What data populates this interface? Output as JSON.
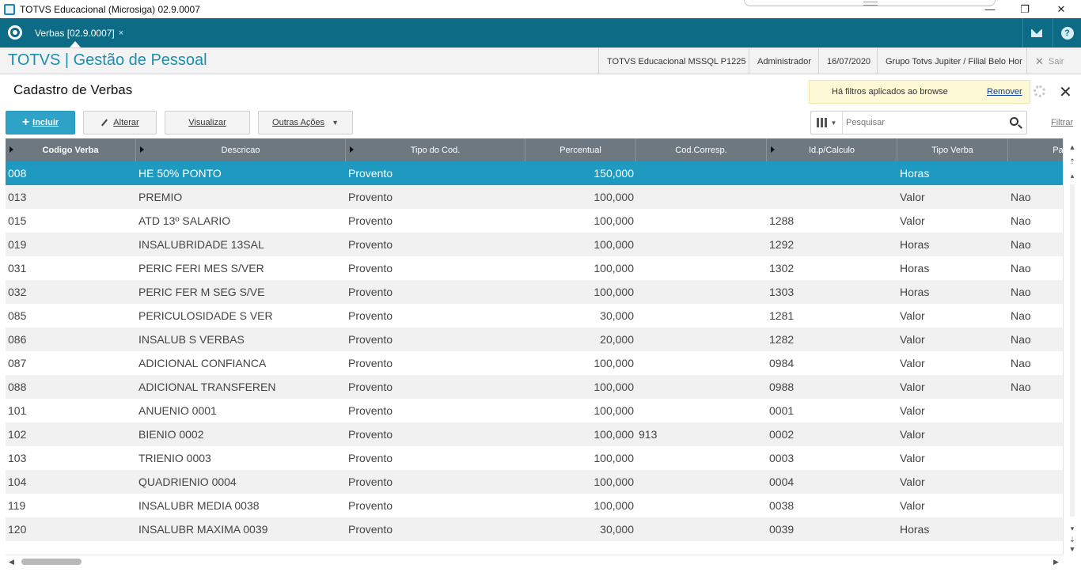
{
  "window": {
    "title": "TOTVS Educacional (Microsiga) 02.9.0007",
    "minimize": "—",
    "maximize": "❐",
    "close": "✕"
  },
  "topbar": {
    "tab_label": "Verbas [02.9.0007]",
    "tab_close": "×",
    "help": "?"
  },
  "header": {
    "brand": "TOTVS | Gestão de Pessoal",
    "environment": "TOTVS Educacional MSSQL P1225",
    "user": "Administrador",
    "date": "16/07/2020",
    "branch": "Grupo Totvs Jupiter / Filial Belo Hor",
    "exit_label": "Sair",
    "exit_icon": "✕"
  },
  "page": {
    "title": "Cadastro de Verbas",
    "filter_message": "Há filtros aplicados ao browse",
    "filter_remove": "Remover",
    "close": "✕"
  },
  "toolbar": {
    "include": "Incluir",
    "include_icon": "+",
    "alter": "Alterar",
    "view": "Visualizar",
    "other_actions": "Outras Ações",
    "other_caret": "▼",
    "search_placeholder": "Pesquisar",
    "columns_caret": "▼",
    "filter": "Filtrar"
  },
  "colors": {
    "topbar": "#0c6b85",
    "brand": "#1a8fb0",
    "selected_row": "#1e9ac0",
    "primary_button": "#2ea3c7",
    "grid_header": "#6e7880"
  },
  "grid": {
    "columns": [
      "Codigo Verba",
      "Descricao",
      "Tipo do Cod.",
      "Percentual",
      "Cod.Corresp.",
      "Id.p/Calculo",
      "Tipo Verba",
      "Pag"
    ],
    "rows": [
      [
        "008",
        "HE 50% PONTO",
        "Provento",
        "150,000",
        "",
        "",
        "Horas",
        ""
      ],
      [
        "013",
        "PREMIO",
        "Provento",
        "100,000",
        "",
        "",
        "Valor",
        "Nao"
      ],
      [
        "015",
        "ATD 13º SALARIO",
        "Provento",
        "100,000",
        "",
        "1288",
        "Valor",
        "Nao"
      ],
      [
        "019",
        "INSALUBRIDADE 13SAL",
        "Provento",
        "100,000",
        "",
        "1292",
        "Horas",
        "Nao"
      ],
      [
        "031",
        "PERIC FERI MES S/VER",
        "Provento",
        "100,000",
        "",
        "1302",
        "Horas",
        "Nao"
      ],
      [
        "032",
        "PERIC FER M SEG S/VE",
        "Provento",
        "100,000",
        "",
        "1303",
        "Horas",
        "Nao"
      ],
      [
        "085",
        "PERICULOSIDADE S VER",
        "Provento",
        "30,000",
        "",
        "1281",
        "Valor",
        "Nao"
      ],
      [
        "086",
        "INSALUB S VERBAS",
        "Provento",
        "20,000",
        "",
        "1282",
        "Valor",
        "Nao"
      ],
      [
        "087",
        "ADICIONAL CONFIANCA",
        "Provento",
        "100,000",
        "",
        "0984",
        "Valor",
        "Nao"
      ],
      [
        "088",
        "ADICIONAL TRANSFEREN",
        "Provento",
        "100,000",
        "",
        "0988",
        "Valor",
        "Nao"
      ],
      [
        "101",
        "ANUENIO 0001",
        "Provento",
        "100,000",
        "",
        "0001",
        "Valor",
        ""
      ],
      [
        "102",
        "BIENIO 0002",
        "Provento",
        "100,000",
        "913",
        "0002",
        "Valor",
        ""
      ],
      [
        "103",
        "TRIENIO 0003",
        "Provento",
        "100,000",
        "",
        "0003",
        "Valor",
        ""
      ],
      [
        "104",
        "QUADRIENIO 0004",
        "Provento",
        "100,000",
        "",
        "0004",
        "Valor",
        ""
      ],
      [
        "119",
        "INSALUBR MEDIA 0038",
        "Provento",
        "100,000",
        "",
        "0038",
        "Valor",
        ""
      ],
      [
        "120",
        "INSALUBR MAXIMA 0039",
        "Provento",
        "30,000",
        "",
        "0039",
        "Horas",
        ""
      ]
    ]
  }
}
